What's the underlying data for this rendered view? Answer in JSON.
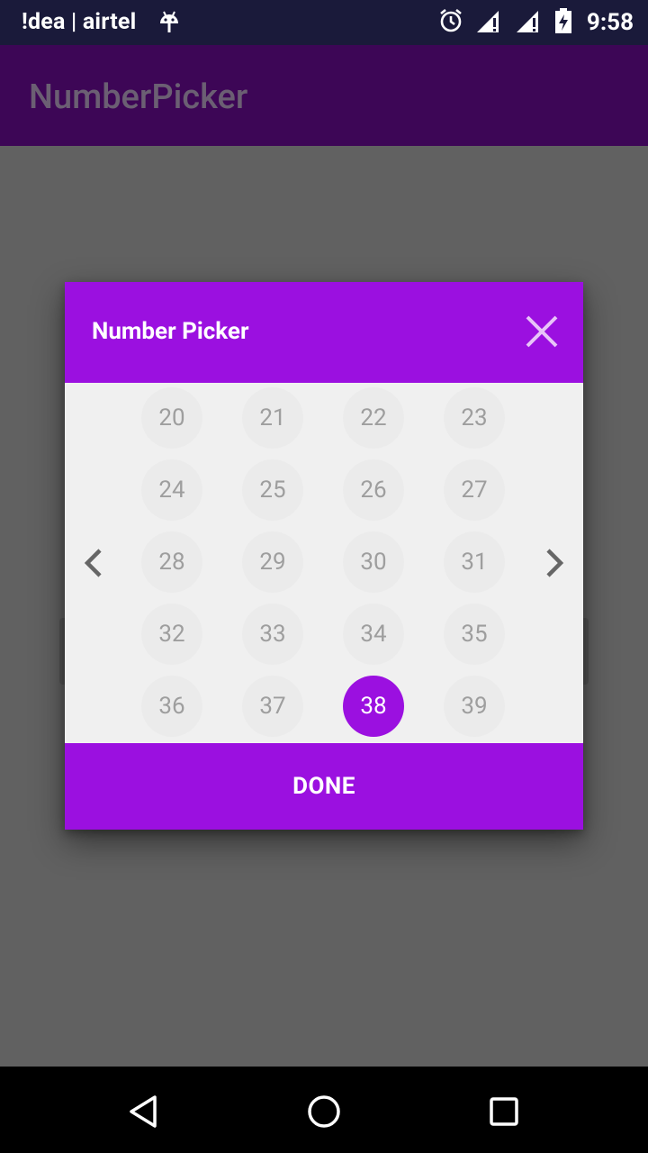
{
  "status_bar": {
    "carrier": "!dea | airtel",
    "time": "9:58"
  },
  "app_bar": {
    "title": "NumberPicker"
  },
  "dialog": {
    "title": "Number Picker",
    "done_label": "DONE",
    "numbers": [
      "20",
      "21",
      "22",
      "23",
      "24",
      "25",
      "26",
      "27",
      "28",
      "29",
      "30",
      "31",
      "32",
      "33",
      "34",
      "35",
      "36",
      "37",
      "38",
      "39"
    ],
    "selected": "38"
  },
  "colors": {
    "primary": "#9b10e0",
    "app_bar": "#3d0656",
    "scrim": "#616161"
  },
  "icons": {
    "close": "close-icon",
    "prev": "chevron-left-icon",
    "next": "chevron-right-icon",
    "back": "back-triangle-icon",
    "home": "home-circle-icon",
    "recents": "recents-square-icon"
  }
}
